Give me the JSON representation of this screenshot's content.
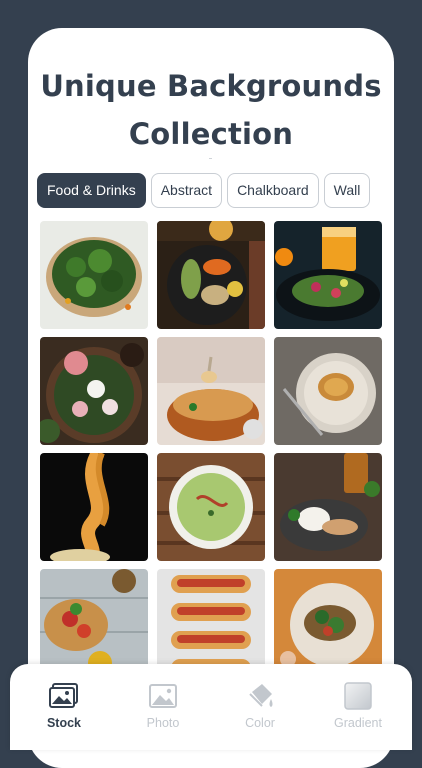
{
  "header": {
    "title_line1": "Unique Backgrounds",
    "title_line2": "Collection"
  },
  "categories": [
    {
      "label": "Food & Drinks",
      "active": true
    },
    {
      "label": "Abstract",
      "active": false
    },
    {
      "label": "Chalkboard",
      "active": false
    },
    {
      "label": "Wall",
      "active": false
    }
  ],
  "photos": [
    "spinach-quiche-photo",
    "buddha-bowl-photo",
    "salad-juice-photo",
    "radish-salad-photo",
    "noodle-soup-photo",
    "fried-cutlet-photo",
    "spaghetti-fork-photo",
    "green-soup-photo",
    "rice-plate-photo",
    "bruschetta-photo",
    "hot-dogs-photo",
    "toast-greens-photo"
  ],
  "tabbar": {
    "tabs": [
      {
        "label": "Stock",
        "icon": "photo-stack-icon",
        "active": true
      },
      {
        "label": "Photo",
        "icon": "photo-icon",
        "active": false
      },
      {
        "label": "Color",
        "icon": "paint-bucket-icon",
        "active": false
      },
      {
        "label": "Gradient",
        "icon": "gradient-square-icon",
        "active": false
      }
    ]
  }
}
